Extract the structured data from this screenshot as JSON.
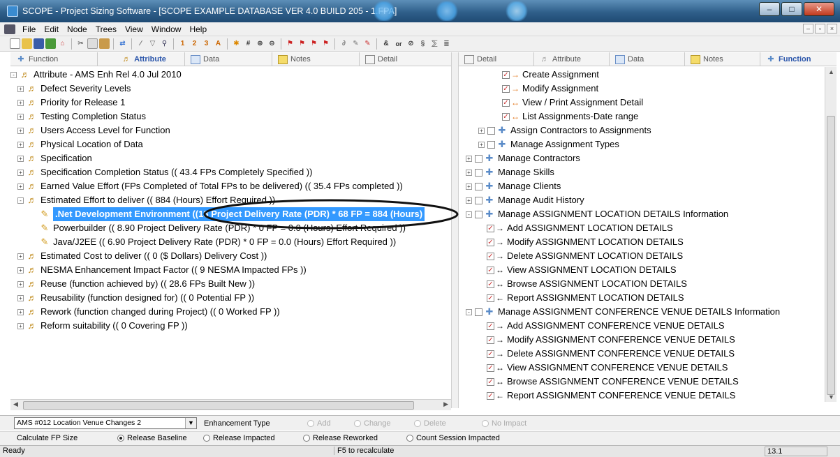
{
  "window": {
    "title": "SCOPE - Project Sizing Software  - [SCOPE EXAMPLE DATABASE VER 4.0 BUILD 205 - 1.FPA]"
  },
  "menu": [
    "File",
    "Edit",
    "Node",
    "Trees",
    "View",
    "Window",
    "Help"
  ],
  "left_tabs": [
    {
      "label": "Function",
      "icon": "function-icon"
    },
    {
      "label": "Attribute",
      "icon": "attribute-icon",
      "active": true
    },
    {
      "label": "Data",
      "icon": "data-icon"
    },
    {
      "label": "Notes",
      "icon": "notes-icon"
    },
    {
      "label": "Detail",
      "icon": "detail-icon"
    }
  ],
  "right_tabs": [
    {
      "label": "Detail",
      "icon": "detail-icon"
    },
    {
      "label": "Attribute",
      "icon": "attribute-icon"
    },
    {
      "label": "Data",
      "icon": "data-icon"
    },
    {
      "label": "Notes",
      "icon": "notes-icon"
    },
    {
      "label": "Function",
      "icon": "function-icon",
      "active": true
    }
  ],
  "left_tree": [
    {
      "label": "Attribute - AMS Enh Rel 4.0 Jul 2010",
      "level": 0,
      "expander": "-",
      "icon": "attribute"
    },
    {
      "label": "Defect Severity Levels",
      "level": 1,
      "expander": "+",
      "icon": "attribute"
    },
    {
      "label": "Priority for Release 1",
      "level": 1,
      "expander": "+",
      "icon": "attribute"
    },
    {
      "label": "Testing Completion Status",
      "level": 1,
      "expander": "+",
      "icon": "attribute"
    },
    {
      "label": "Users Access Level for Function",
      "level": 1,
      "expander": "+",
      "icon": "attribute"
    },
    {
      "label": "Physical Location of Data",
      "level": 1,
      "expander": "+",
      "icon": "attribute"
    },
    {
      "label": "Specification",
      "level": 1,
      "expander": "+",
      "icon": "attribute"
    },
    {
      "label": "Specification Completion Status   (( 43.4  FPs Completely Specified ))",
      "level": 1,
      "expander": "+",
      "icon": "attribute"
    },
    {
      "label": "Earned Value Effort  (FPs Completed of Total FPs to be delivered)   (( 35.4  FPs completed ))",
      "level": 1,
      "expander": "+",
      "icon": "attribute"
    },
    {
      "label": "Estimated Effort to deliver   (( 884  (Hours)  Effort Required ))",
      "level": 1,
      "expander": "-",
      "icon": "attribute"
    },
    {
      "label": ".Net Development Environment   ((13 Project Delivery Rate (PDR) * 68 FP = 884 (Hours)",
      "level": 2,
      "icon": "pencil",
      "selected": true
    },
    {
      "label": "Powerbuilder   (( 8.90 Project Delivery Rate (PDR) * 0 FP = 0.0 (Hours)  Effort Required ))",
      "level": 2,
      "icon": "pencil"
    },
    {
      "label": "Java/J2EE   (( 6.90 Project Delivery Rate (PDR) * 0 FP = 0.0 (Hours)  Effort Required ))",
      "level": 2,
      "icon": "pencil"
    },
    {
      "label": "Estimated Cost to deliver   (( 0  ($ Dollars) Delivery Cost ))",
      "level": 1,
      "expander": "+",
      "icon": "attribute"
    },
    {
      "label": "NESMA Enhancement Impact Factor   (( 9  NESMA Impacted FPs ))",
      "level": 1,
      "expander": "+",
      "icon": "attribute"
    },
    {
      "label": "Reuse (function achieved by)   (( 28.6  FPs Built New ))",
      "level": 1,
      "expander": "+",
      "icon": "attribute"
    },
    {
      "label": "Reusability (function designed for)   (( 0  Potential FP ))",
      "level": 1,
      "expander": "+",
      "icon": "attribute"
    },
    {
      "label": "Rework (function changed during Project)   (( 0  Worked FP ))",
      "level": 1,
      "expander": "+",
      "icon": "attribute"
    },
    {
      "label": "Reform suitability   (( 0  Covering FP ))",
      "level": 1,
      "expander": "+",
      "icon": "attribute"
    }
  ],
  "right_tree": [
    {
      "label": "Create Assignment",
      "level": 2,
      "check": true,
      "arrow": "→"
    },
    {
      "label": "Modify Assignment",
      "level": 2,
      "check": true,
      "arrow": "→"
    },
    {
      "label": "View / Print Assignment Detail",
      "level": 2,
      "check": true,
      "arrow": "↔"
    },
    {
      "label": "List Assignments-Date range",
      "level": 2,
      "check": true,
      "arrow": "↔"
    },
    {
      "label": "Assign Contractors to Assignments",
      "level": 1,
      "expander": "+",
      "check": true,
      "func": true
    },
    {
      "label": "Manage Assignment Types",
      "level": 1,
      "expander": "+",
      "check": true,
      "func": true
    },
    {
      "label": "Manage Contractors",
      "level": 0,
      "expander": "+",
      "check": true,
      "func": true
    },
    {
      "label": "Manage Skills",
      "level": 0,
      "expander": "+",
      "check": true,
      "func": true
    },
    {
      "label": "Manage Clients",
      "level": 0,
      "expander": "+",
      "check": true,
      "func": true
    },
    {
      "label": "Manage Audit History",
      "level": 0,
      "expander": "+",
      "check": true,
      "func": true
    },
    {
      "label": "Manage ASSIGNMENT LOCATION DETAILS Information",
      "level": 0,
      "expander": "-",
      "check": true,
      "func": true
    },
    {
      "label": "Add ASSIGNMENT LOCATION DETAILS",
      "level": 1,
      "check": true,
      "arrow": "→"
    },
    {
      "label": "Modify ASSIGNMENT LOCATION DETAILS",
      "level": 1,
      "check": true,
      "arrow": "→"
    },
    {
      "label": "Delete ASSIGNMENT LOCATION DETAILS",
      "level": 1,
      "check": true,
      "arrow": "→"
    },
    {
      "label": "View ASSIGNMENT LOCATION DETAILS",
      "level": 1,
      "check": true,
      "arrow": "↔"
    },
    {
      "label": "Browse ASSIGNMENT LOCATION DETAILS",
      "level": 1,
      "check": true,
      "arrow": "↔"
    },
    {
      "label": "Report ASSIGNMENT LOCATION DETAILS",
      "level": 1,
      "check": true,
      "arrow": "←"
    },
    {
      "label": "Manage ASSIGNMENT CONFERENCE VENUE DETAILS Information",
      "level": 0,
      "expander": "-",
      "check": true,
      "func": true
    },
    {
      "label": "Add ASSIGNMENT CONFERENCE VENUE DETAILS",
      "level": 1,
      "check": true,
      "arrow": "→"
    },
    {
      "label": "Modify ASSIGNMENT CONFERENCE VENUE DETAILS",
      "level": 1,
      "check": true,
      "arrow": "→"
    },
    {
      "label": "Delete ASSIGNMENT CONFERENCE VENUE DETAILS",
      "level": 1,
      "check": true,
      "arrow": "→"
    },
    {
      "label": "View ASSIGNMENT CONFERENCE VENUE DETAILS",
      "level": 1,
      "check": true,
      "arrow": "↔"
    },
    {
      "label": "Browse ASSIGNMENT CONFERENCE VENUE DETAILS",
      "level": 1,
      "check": true,
      "arrow": "↔"
    },
    {
      "label": "Report ASSIGNMENT CONFERENCE VENUE DETAILS",
      "level": 1,
      "check": true,
      "arrow": "←"
    }
  ],
  "enhancement": {
    "selected": "AMS #012 Location Venue Changes 2",
    "label": "Enhancement Type",
    "options": [
      "Add",
      "Change",
      "Delete",
      "No Impact"
    ]
  },
  "calc": {
    "label": "Calculate FP Size",
    "options": [
      "Release Baseline",
      "Release Impacted",
      "Release Reworked",
      "Count Session Impacted"
    ],
    "selected": "Release Baseline"
  },
  "status": {
    "left": "Ready",
    "center": "F5 to recalculate",
    "right": "13.1"
  },
  "colors": {
    "selection": "#3399ff",
    "title_bar": "#2f5f8a"
  }
}
